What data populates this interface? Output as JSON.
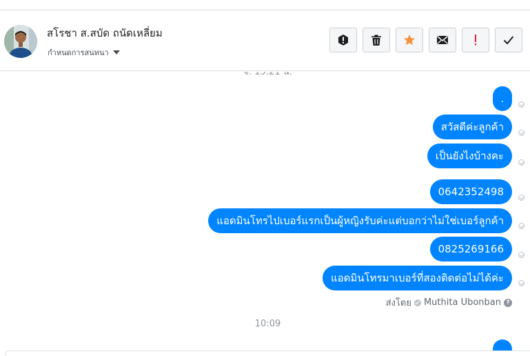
{
  "header": {
    "contact_name": "สโรชา ส.สบัด ถนัดเหลี่ยม",
    "conversation_settings": "กำหนดการสนทนา",
    "actions": [
      {
        "name": "spam-button",
        "icon": "exclamation-circle-icon"
      },
      {
        "name": "delete-button",
        "icon": "trash-icon"
      },
      {
        "name": "star-button",
        "icon": "star-icon",
        "color": "#f7923b"
      },
      {
        "name": "mark-unread-button",
        "icon": "envelope-icon"
      },
      {
        "name": "follow-up-button",
        "icon": "exclamation-icon",
        "color": "#e41e3f"
      },
      {
        "name": "mark-done-button",
        "icon": "check-icon"
      }
    ]
  },
  "thread": {
    "timestamp_top": "จ. 15:21 น.",
    "messages": [
      {
        "text": "."
      },
      {
        "text": "สวัสดีค่ะลูกค้า"
      },
      {
        "text": "เป็นยังไงบ้างคะ"
      },
      {
        "text": "0642352498"
      },
      {
        "text": "แอดมินโทรไปเบอร์แรกเป็นผู้หญิงรับค่ะแต่บอกว่าไม่ใช่เบอร์ลูกค้า"
      },
      {
        "text": "0825269166"
      },
      {
        "text": "แอดมินโทรมาเบอร์ที่สองติดต่อไม่ได้ค่ะ"
      }
    ],
    "sent_by_label": "ส่งโดย",
    "sent_by_name": "Muthita Ubonban",
    "timestamp_bottom": "10:09"
  },
  "colors": {
    "bubble": "#0084ff",
    "accent_star": "#f7923b",
    "accent_alert": "#e41e3f"
  }
}
